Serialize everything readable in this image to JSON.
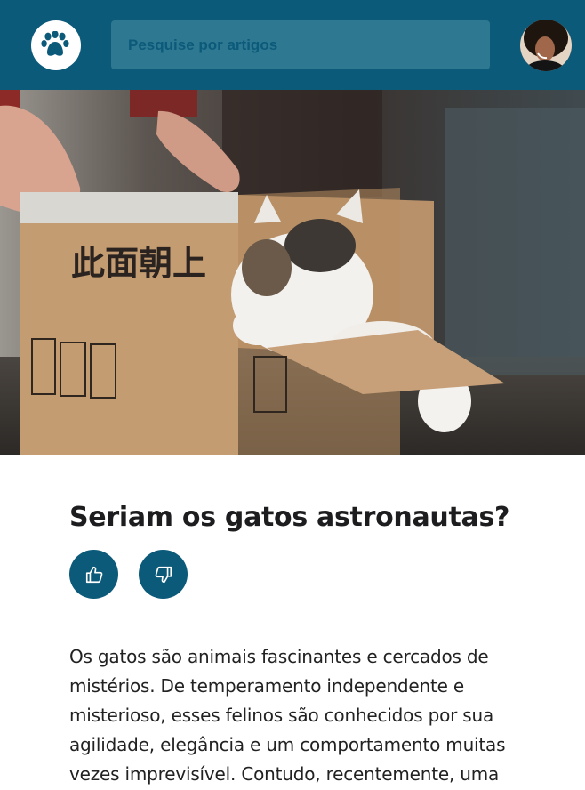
{
  "header": {
    "search_placeholder": "Pesquise por artigos",
    "logo_icon": "paw-icon",
    "avatar_icon": "user-avatar"
  },
  "article": {
    "hero_text": "此面朝上",
    "title": "Seriam os gatos astronautas?",
    "like_icon": "thumbs-up-icon",
    "dislike_icon": "thumbs-down-icon",
    "body": "Os gatos são animais fascinantes e cercados de mistérios. De temperamento independente e misterioso, esses felinos são conhecidos por sua agilidade, elegância e um comportamento muitas vezes imprevisível. Contudo, recentemente, uma"
  },
  "colors": {
    "primary": "#0c5a7a",
    "search_bg": "#2e7891",
    "text": "#1d1d1f"
  }
}
